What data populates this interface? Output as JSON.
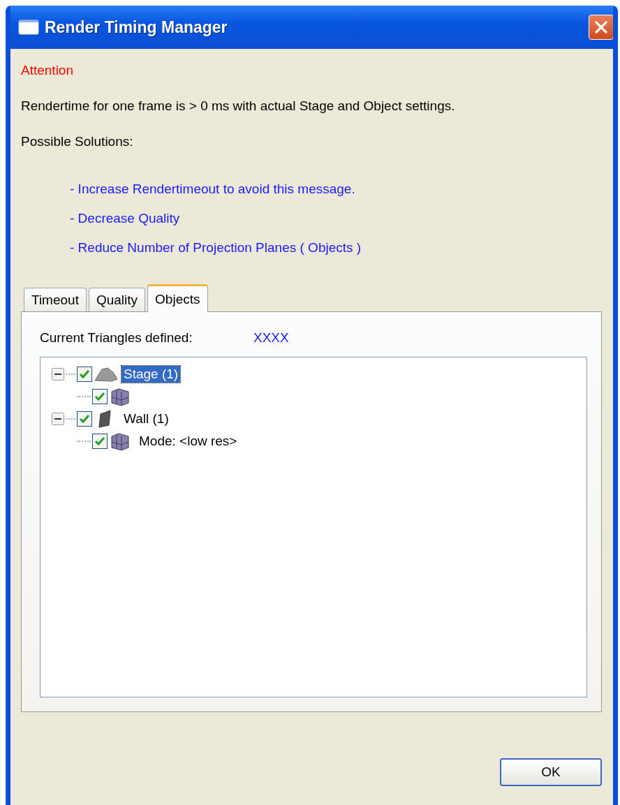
{
  "window": {
    "title": "Render Timing Manager"
  },
  "attention": "Attention",
  "message": "Rendertime for one frame is > 0 ms with actual Stage and Object settings.",
  "solutions_heading": "Possible Solutions:",
  "solutions": [
    "- Increase Rendertimeout to avoid this message.",
    "- Decrease Quality",
    "- Reduce Number of Projection Planes ( Objects )"
  ],
  "tabs": [
    {
      "label": "Timeout",
      "selected": false
    },
    {
      "label": "Quality",
      "selected": false
    },
    {
      "label": "Objects",
      "selected": true
    }
  ],
  "triangles": {
    "label": "Current Triangles defined:",
    "value": "XXXX"
  },
  "tree": [
    {
      "label": "Stage (1)",
      "kind": "stage",
      "checked": true,
      "selected": true,
      "expanded": true,
      "children": [
        {
          "kind": "mesh",
          "checked": true
        }
      ]
    },
    {
      "label": "Wall (1)",
      "kind": "wall",
      "checked": true,
      "selected": false,
      "expanded": true,
      "children": [
        {
          "label": "Mode: <low res>",
          "kind": "mesh",
          "checked": true,
          "selected": false
        }
      ]
    }
  ],
  "buttons": [
    "OK"
  ]
}
